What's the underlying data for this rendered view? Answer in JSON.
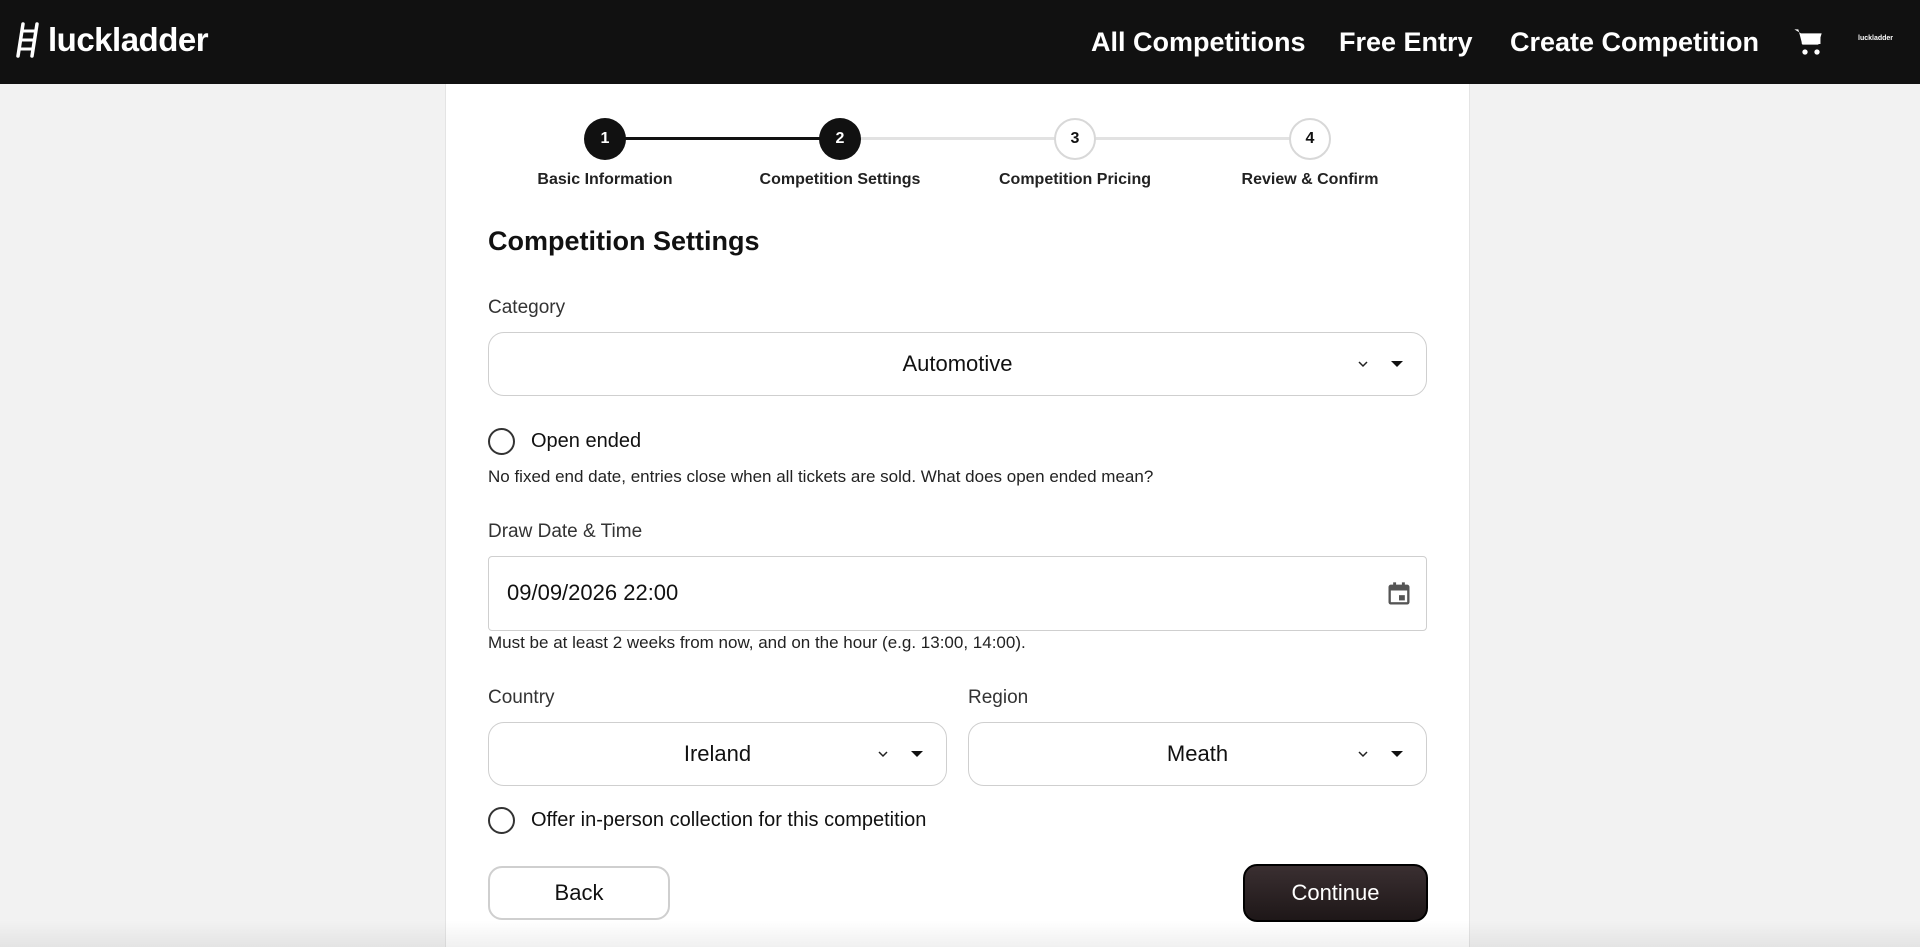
{
  "header": {
    "brand": "luckladder",
    "nav": {
      "all_competitions": "All Competitions",
      "free_entry": "Free Entry",
      "create_competition": "Create Competition"
    },
    "cart_icon": "cart-icon",
    "mini_brand": "luckladder"
  },
  "stepper": {
    "current_step": 2,
    "steps": [
      {
        "number": "1",
        "label": "Basic Information"
      },
      {
        "number": "2",
        "label": "Competition Settings"
      },
      {
        "number": "3",
        "label": "Competition Pricing"
      },
      {
        "number": "4",
        "label": "Review & Confirm"
      }
    ]
  },
  "form": {
    "title": "Competition Settings",
    "category": {
      "label": "Category",
      "value": "Automotive"
    },
    "open_ended": {
      "label": "Open ended",
      "checked": false,
      "help": "No fixed end date, entries close when all tickets are sold. What does open ended mean?"
    },
    "draw_date": {
      "label": "Draw Date & Time",
      "value": "09/09/2026 22:00",
      "help": "Must be at least 2 weeks from now, and on the hour (e.g. 13:00, 14:00)."
    },
    "country": {
      "label": "Country",
      "value": "Ireland"
    },
    "region": {
      "label": "Region",
      "value": "Meath"
    },
    "in_person": {
      "label": "Offer in-person collection for this competition",
      "checked": false
    },
    "buttons": {
      "back": "Back",
      "continue": "Continue"
    }
  },
  "colors": {
    "header_bg": "#111111",
    "accent": "#111111",
    "continue_bg": "#2b2223",
    "page_bg": "#f2f2f2"
  }
}
